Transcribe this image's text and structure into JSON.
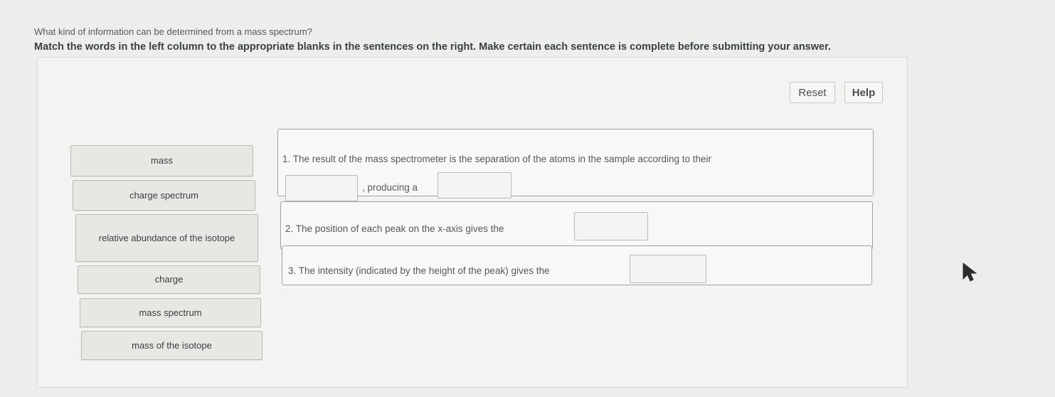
{
  "question": "What kind of information can be determined from a mass spectrum?",
  "instructions": "Match the words in the left column to the appropriate blanks in the sentences on the right. Make certain each sentence is complete before submitting your answer.",
  "buttons": {
    "reset": "Reset",
    "help": "Help"
  },
  "word_bank": [
    "mass",
    "charge spectrum",
    "relative abundance of the isotope",
    "charge",
    "mass spectrum",
    "mass of the isotope"
  ],
  "sentences": [
    {
      "part1": "1. The result of the mass spectrometer is the separation of the atoms in the sample according to their",
      "part2": ", producing a"
    },
    {
      "part1": "2. The position of each peak on the x-axis gives the"
    },
    {
      "part1": "3. The intensity (indicated by the height of the peak) gives the"
    }
  ],
  "icons": {
    "cursor": "mouse-pointer-icon"
  }
}
